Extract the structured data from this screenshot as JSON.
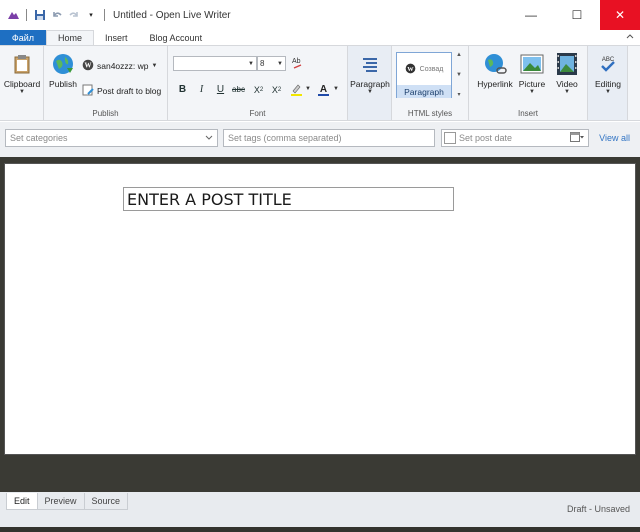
{
  "window": {
    "title": "Untitled - Open Live Writer",
    "controls": {
      "minimize": "—",
      "maximize": "☐",
      "close": "✕"
    }
  },
  "ribbon_tabs": [
    {
      "label": "Файл"
    },
    {
      "label": "Home"
    },
    {
      "label": "Insert"
    },
    {
      "label": "Blog Account"
    }
  ],
  "ribbon": {
    "clipboard": {
      "label": "Clipboard"
    },
    "publish_group": {
      "publish_label": "Publish",
      "account_label": "san4ozzz: wp",
      "post_draft_label": "Post draft to blog",
      "group_label": "Publish"
    },
    "font_group": {
      "font_name": "",
      "font_size": "8",
      "group_label": "Font"
    },
    "paragraph_group": {
      "label": "Paragraph"
    },
    "styles_group": {
      "preview_text": "Созвад",
      "selected_label": "Paragraph",
      "group_label": "HTML styles"
    },
    "insert_group": {
      "hyperlink_label": "Hyperlink",
      "picture_label": "Picture",
      "video_label": "Video",
      "group_label": "Insert"
    },
    "editing_group": {
      "label": "Editing"
    }
  },
  "properties": {
    "categories_placeholder": "Set categories",
    "tags_placeholder": "Set tags (comma separated)",
    "date_placeholder": "Set post date",
    "view_all": "View all"
  },
  "editor": {
    "title_placeholder": "ENTER A POST TITLE"
  },
  "view_tabs": [
    {
      "label": "Edit"
    },
    {
      "label": "Preview"
    },
    {
      "label": "Source"
    }
  ],
  "status": "Draft - Unsaved"
}
